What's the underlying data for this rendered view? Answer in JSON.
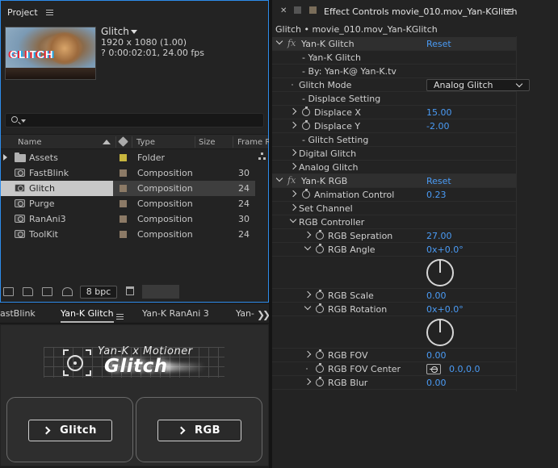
{
  "project": {
    "tab_label": "Project",
    "comp_name": "Glitch",
    "resolution": "1920 x 1080 (1.00)",
    "duration": "? 0:00:02:01, 24.00 fps",
    "thumb_text": "GLITCH",
    "search_placeholder": "",
    "columns": {
      "name": "Name",
      "type": "Type",
      "size": "Size",
      "frame_rate": "Frame Ra"
    },
    "items": [
      {
        "name": "Assets",
        "type": "Folder",
        "frame_rate": "",
        "color": "#c8b63e",
        "kind": "folder"
      },
      {
        "name": "FastBlink",
        "type": "Composition",
        "frame_rate": "30",
        "color": "#8c7a66",
        "kind": "comp"
      },
      {
        "name": "Glitch",
        "type": "Composition",
        "frame_rate": "24",
        "color": "#8c7a66",
        "kind": "comp",
        "selected": true
      },
      {
        "name": "Purge",
        "type": "Composition",
        "frame_rate": "24",
        "color": "#8c7a66",
        "kind": "comp"
      },
      {
        "name": "RanAni3",
        "type": "Composition",
        "frame_rate": "30",
        "color": "#8c7a66",
        "kind": "comp"
      },
      {
        "name": "ToolKit",
        "type": "Composition",
        "frame_rate": "24",
        "color": "#8c7a66",
        "kind": "comp"
      }
    ],
    "bpc": "8 bpc"
  },
  "bottom_tabs": [
    {
      "label": "astBlink",
      "active": false
    },
    {
      "label": "Yan-K Glitch",
      "active": true
    },
    {
      "label": "Yan-K RanAni 3",
      "active": false
    },
    {
      "label": "Yan-",
      "active": false
    }
  ],
  "extension": {
    "logo_line1": "Yan-K x Motioner",
    "logo_line2": "Glitch",
    "button_glitch": "Glitch",
    "button_rgb": "RGB"
  },
  "effect_controls": {
    "tab_title": "Effect Controls movie_010.mov_Yan-KGlitch",
    "subtitle": "Glitch • movie_010.mov_Yan-KGlitch",
    "reset_label": "Reset",
    "rows": [
      {
        "id": "fx-yank-glitch",
        "label": "Yan-K Glitch",
        "indent": 1,
        "fx": true,
        "reset": true
      },
      {
        "id": "lbl-yank-glitch",
        "label": "- Yan-K Glitch",
        "indent": 2
      },
      {
        "id": "lbl-by",
        "label": "- By: Yan-K@ Yan-K.tv",
        "indent": 2
      },
      {
        "id": "glitch-mode",
        "label": "Glitch Mode",
        "indent": 1,
        "dropdown": "Analog Glitch"
      },
      {
        "id": "lbl-displace",
        "label": "- Displace Setting",
        "indent": 2
      },
      {
        "id": "displace-x",
        "label": "Displace X",
        "indent": 2,
        "stopwatch": true,
        "expand": "right",
        "value": "15.00"
      },
      {
        "id": "displace-y",
        "label": "Displace Y",
        "indent": 2,
        "stopwatch": true,
        "expand": "right",
        "value": "-2.00"
      },
      {
        "id": "lbl-glitch-setting",
        "label": "- Glitch Setting",
        "indent": 2
      },
      {
        "id": "digital-glitch",
        "label": "Digital Glitch",
        "indent": 1,
        "expand": "right"
      },
      {
        "id": "analog-glitch",
        "label": "Analog Glitch",
        "indent": 1,
        "expand": "right"
      },
      {
        "id": "fx-yank-rgb",
        "label": "Yan-K RGB",
        "indent": 1,
        "fx": true,
        "reset": true
      },
      {
        "id": "animation-control",
        "label": "Animation Control",
        "indent": 2,
        "stopwatch": true,
        "expand": "right",
        "value": "0.23"
      },
      {
        "id": "set-channel",
        "label": "Set Channel",
        "indent": 1,
        "expand": "right"
      },
      {
        "id": "rgb-controller",
        "label": "RGB Controller",
        "indent": 1,
        "expand": "down"
      },
      {
        "id": "rgb-separation",
        "label": "RGB Sepration",
        "indent": 3,
        "stopwatch": true,
        "expand": "right",
        "value": "27.00"
      },
      {
        "id": "rgb-angle",
        "label": "RGB Angle",
        "indent": 3,
        "stopwatch": true,
        "expand": "down",
        "value": "0x+0.0°",
        "dial": true
      },
      {
        "id": "rgb-scale",
        "label": "RGB Scale",
        "indent": 3,
        "stopwatch": true,
        "expand": "right",
        "value": "0.00"
      },
      {
        "id": "rgb-rotation",
        "label": "RGB Rotation",
        "indent": 3,
        "stopwatch": true,
        "expand": "down",
        "value": "0x+0.0°",
        "dial": true
      },
      {
        "id": "rgb-fov",
        "label": "RGB FOV",
        "indent": 3,
        "stopwatch": true,
        "expand": "right",
        "value": "0.00"
      },
      {
        "id": "rgb-fov-center",
        "label": "RGB FOV Center",
        "indent": 3,
        "stopwatch": true,
        "value": "0.0,0.0",
        "point": true
      },
      {
        "id": "rgb-blur",
        "label": "RGB Blur",
        "indent": 3,
        "stopwatch": true,
        "expand": "right",
        "value": "0.00"
      }
    ]
  }
}
